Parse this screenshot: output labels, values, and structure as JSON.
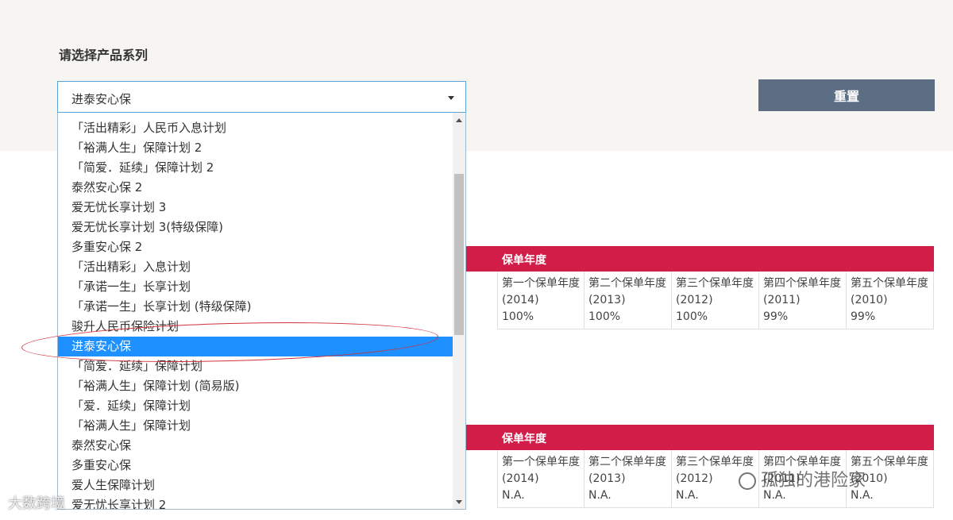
{
  "filter": {
    "label": "请选择产品系列",
    "selected_value": "进泰安心保",
    "reset_label": "重置"
  },
  "dropdown": {
    "options": [
      "「活出精彩」人民币入息计划",
      "「裕满人生」保障计划 2",
      "「简爱．延续」保障计划 2",
      "泰然安心保 2",
      "爱无忧长享计划 3",
      "爱无忧长享计划 3(特级保障)",
      "多重安心保 2",
      "「活出精彩」入息计划",
      "「承诺一生」长享计划",
      "「承诺一生」长享计划 (特级保障)",
      "骏升人民币保险计划",
      "进泰安心保",
      "「简爱．延续」保障计划",
      "「裕满人生」保障计划 (简易版)",
      "「爱．延续」保障计划",
      "「裕满人生」保障计划",
      "泰然安心保",
      "多重安心保",
      "爱人生保障计划",
      "爱无忧长享计划 2"
    ],
    "selected_index": 11
  },
  "tables": [
    {
      "header": "保单年度",
      "columns": [
        {
          "label": "第一个保单年度(2014)",
          "value": "100%"
        },
        {
          "label": "第二个保单年度(2013)",
          "value": "100%"
        },
        {
          "label": "第三个保单年度(2012)",
          "value": "100%"
        },
        {
          "label": "第四个保单年度(2011)",
          "value": "99%"
        },
        {
          "label": "第五个保单年度(2010)",
          "value": "99%"
        }
      ]
    },
    {
      "header": "保单年度",
      "columns": [
        {
          "label": "第一个保单年度(2014)",
          "value": "N.A."
        },
        {
          "label": "第二个保单年度(2013)",
          "value": "N.A."
        },
        {
          "label": "第三个保单年度(2012)",
          "value": "N.A."
        },
        {
          "label": "第四个保单年度(2011)",
          "value": "N.A."
        },
        {
          "label": "第五个保单年度(2010)",
          "value": "N.A."
        }
      ]
    }
  ],
  "watermarks": {
    "left": "大数跨境",
    "right": "孤独的港险家"
  },
  "colors": {
    "accent_red": "#d21d48",
    "selected_blue": "#1e90ff",
    "reset_button": "#5c6e83"
  }
}
